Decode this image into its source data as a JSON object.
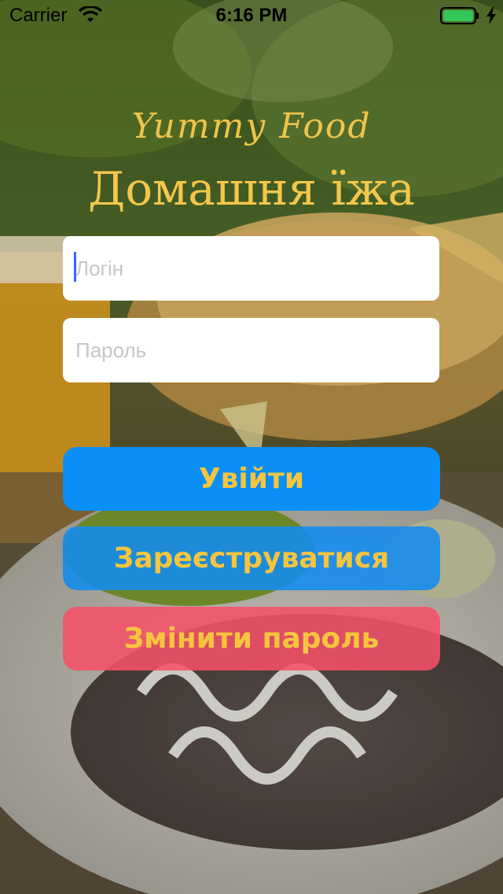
{
  "status_bar": {
    "carrier": "Carrier",
    "time": "6:16 PM",
    "icons": [
      "wifi-icon",
      "battery-icon",
      "charge-icon"
    ],
    "battery_color": "#34c759"
  },
  "brand": {
    "script_logo": "Yummy Food",
    "title": "Домашня їжа",
    "title_color": "#f5c64a"
  },
  "form": {
    "login": {
      "placeholder": "Логін",
      "value": ""
    },
    "password": {
      "placeholder": "Пароль",
      "value": ""
    }
  },
  "buttons": {
    "login": "Увійти",
    "register": "Зареєструватися",
    "change_password": "Змінити пароль"
  },
  "colors": {
    "primary_button": "#0a8ff7",
    "register_button": "#128cf0",
    "change_button": "#f55069",
    "button_text": "#f6c53e"
  }
}
